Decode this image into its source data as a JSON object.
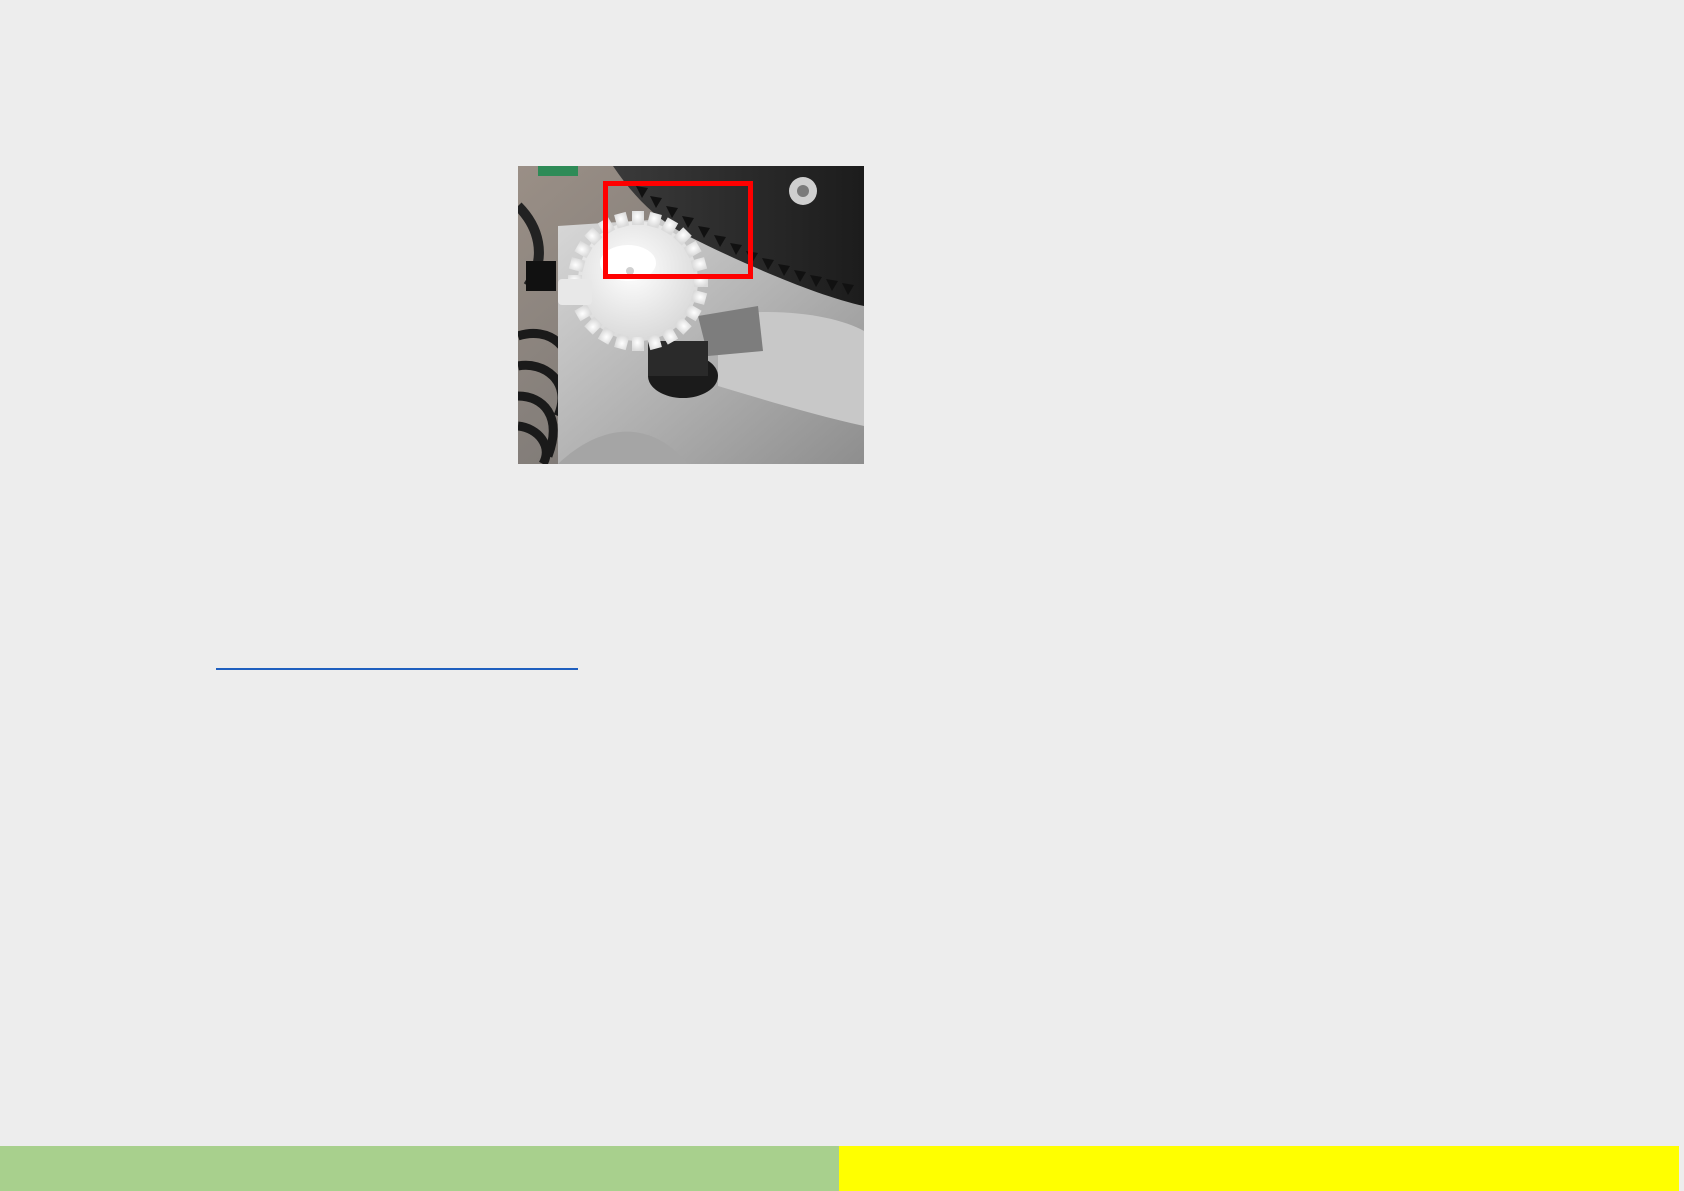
{
  "figure": {
    "icon": "gear-photo",
    "highlight_color": "#ff0000"
  },
  "link": {
    "color": "#1f5fbf"
  },
  "footer": {
    "left_color": "#a8d08d",
    "right_color": "#ffff00",
    "edge_color": "#ededed"
  }
}
